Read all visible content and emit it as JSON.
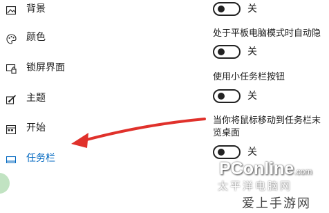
{
  "sidebar": {
    "items": [
      {
        "label": "背景",
        "icon": "image-icon"
      },
      {
        "label": "颜色",
        "icon": "palette-icon"
      },
      {
        "label": "锁屏界面",
        "icon": "lock-screen-icon"
      },
      {
        "label": "主题",
        "icon": "brush-icon"
      },
      {
        "label": "开始",
        "icon": "start-icon"
      },
      {
        "label": "任务栏",
        "icon": "taskbar-icon"
      }
    ],
    "active_item": "任务栏"
  },
  "settings": {
    "top_toggle": {
      "state": "关"
    },
    "tablet_autohide": {
      "title": "处于平板电脑模式时自动隐",
      "state": "关"
    },
    "small_buttons": {
      "title": "使用小任务栏按钮",
      "state": "关"
    },
    "peek": {
      "title_line1": "当你将鼠标移动到任务栏末",
      "title_line2": "览桌面",
      "state": "关"
    }
  },
  "watermark": {
    "brand": "PConline",
    "brand_suffix": ".com",
    "subtitle": "太平洋电脑网",
    "bottom_text": "爱上手游网"
  },
  "colors": {
    "accent": "#0067c0",
    "arrow": "#e0312b"
  }
}
